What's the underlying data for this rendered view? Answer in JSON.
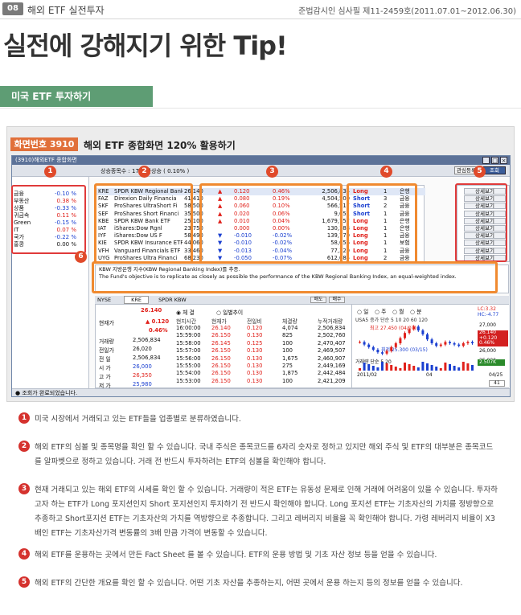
{
  "header": {
    "num": "08",
    "section": "해외 ETF 실전투자",
    "registration": "준법감시인 심사필 제11-2459호(2011.07.01~2012.06.30)"
  },
  "title": "실전에 강해지기 위한 Tip!",
  "subtitle": "미국 ETF 투자하기",
  "caption": {
    "tag": "화면번호 3910",
    "title": "해외 ETF 종합화면 120% 활용하기"
  },
  "window": {
    "title": "(3910)해외ETF 종합화면",
    "toolbar": "상승종목수 : 17   평균상승 (  0.10% )",
    "btn_consult": "관심등록",
    "btn_query": "조회",
    "status": "조회가 완료되었습니다."
  },
  "sectors": [
    {
      "name": "금융",
      "val": "-0.10 %",
      "c": "#1a3fd0"
    },
    {
      "name": "부동산",
      "val": "0.38 %",
      "c": "#e0201a"
    },
    {
      "name": "상품",
      "val": "-0.33 %",
      "c": "#1a3fd0"
    },
    {
      "name": "귀금속",
      "val": "0.11 %",
      "c": "#e0201a"
    },
    {
      "name": "Green",
      "val": "-0.15 %",
      "c": "#1a3fd0"
    },
    {
      "name": "IT",
      "val": "0.07 %",
      "c": "#e0201a"
    },
    {
      "name": "국가",
      "val": "-0.22 %",
      "c": "#1a3fd0"
    },
    {
      "name": "홍콩",
      "val": "0.00 %",
      "c": "#111"
    }
  ],
  "stocks": [
    {
      "sym": "KRE",
      "name": "SPDR KBW Regional Banki",
      "price": "26.140",
      "d": "▲",
      "chg": "0.120",
      "pct": "0.46%",
      "vol": "2,506,834",
      "type": "Long",
      "lev": "1",
      "sec": "은행",
      "up": true
    },
    {
      "sym": "FAZ",
      "name": "Direxion Daily Financia",
      "price": "41.410",
      "d": "▲",
      "chg": "0.080",
      "pct": "0.19%",
      "vol": "4,504,500",
      "type": "Short",
      "lev": "3",
      "sec": "금융",
      "up": true
    },
    {
      "sym": "SKF",
      "name": "ProShares UltraShort Fi",
      "price": "58.500",
      "d": "▲",
      "chg": "0.060",
      "pct": "0.10%",
      "vol": "566,517",
      "type": "Short",
      "lev": "2",
      "sec": "금융",
      "up": true
    },
    {
      "sym": "SEF",
      "name": "ProShares Short Financi",
      "price": "35.500",
      "d": "▲",
      "chg": "0.020",
      "pct": "0.06%",
      "vol": "9,651",
      "type": "Short",
      "lev": "1",
      "sec": "금융",
      "up": true
    },
    {
      "sym": "KBE",
      "name": "SPDR KBW Bank ETF",
      "price": "25.100",
      "d": "▲",
      "chg": "0.010",
      "pct": "0.04%",
      "vol": "1,679,757",
      "type": "Long",
      "lev": "1",
      "sec": "은행",
      "up": true
    },
    {
      "sym": "IAT",
      "name": "iShares:Dow Rgnl",
      "price": "23.750",
      "d": "",
      "chg": "0.000",
      "pct": "0.00%",
      "vol": "130,188",
      "type": "Long",
      "lev": "1",
      "sec": "은행",
      "up": true
    },
    {
      "sym": "IYF",
      "name": "iShares:Dow US F",
      "price": "58.490",
      "d": "▼",
      "chg": "-0.010",
      "pct": "-0.02%",
      "vol": "139,770",
      "type": "Long",
      "lev": "1",
      "sec": "금융",
      "up": false
    },
    {
      "sym": "KIE",
      "name": "SPDR KBW Insurance ETF",
      "price": "44.060",
      "d": "▼",
      "chg": "-0.010",
      "pct": "-0.02%",
      "vol": "58,656",
      "type": "Long",
      "lev": "1",
      "sec": "보험",
      "up": false
    },
    {
      "sym": "VFH",
      "name": "Vanguard Financials ETF",
      "price": "33.460",
      "d": "▼",
      "chg": "-0.013",
      "pct": "-0.04%",
      "vol": "77,320",
      "type": "Long",
      "lev": "1",
      "sec": "금융",
      "up": false
    },
    {
      "sym": "UYG",
      "name": "ProShares Ultra Financi",
      "price": "68.230",
      "d": "▼",
      "chg": "-0.050",
      "pct": "-0.07%",
      "vol": "612,085",
      "type": "Long",
      "lev": "2",
      "sec": "금융",
      "up": false
    }
  ],
  "detail_label": "상세보기",
  "description": {
    "line1": "KBW 지방은행 지수(KBW Regional Banking Index)를 추종.",
    "line2": "The Fund's objective is to replicate as closely as possible the performance of the KBW Regional Banking Index, an equal-weighted index."
  },
  "quote": {
    "market": "NYSE",
    "sym": "KRE",
    "name": "SPDR KBW",
    "price": "26.140",
    "chg": "0.120",
    "pct": "0.46%",
    "lbl_cur": "현재가",
    "lbl_vol": "거래량",
    "lbl_prev": "전일가",
    "lbl_p": "전 일",
    "lbl_o": "시 가",
    "lbl_h": "고 가",
    "lbl_l": "저 가",
    "vol": "2,506,834",
    "prev": "26,020",
    "p": "2,506,834",
    "o": "26,000",
    "h": "26,350",
    "l": "25,980",
    "radio1": "체 결",
    "radio2": "일별추이",
    "btn_buy": "매도",
    "btn_sell": "매수"
  },
  "ticks_head": [
    "현지시간",
    "현재가",
    "전일비",
    "체결량",
    "누적거래량"
  ],
  "ticks": [
    [
      "16:00:00",
      "26.140",
      "0.120",
      "4,074",
      "2,506,834"
    ],
    [
      "15:59:00",
      "26.150",
      "0.130",
      "825",
      "2,502,760"
    ],
    [
      "15:58:00",
      "26.145",
      "0.125",
      "100",
      "2,470,407"
    ],
    [
      "15:57:00",
      "26.150",
      "0.130",
      "100",
      "2,469,507"
    ],
    [
      "15:56:00",
      "26.150",
      "0.130",
      "1,675",
      "2,460,907"
    ],
    [
      "15:55:00",
      "26.150",
      "0.130",
      "275",
      "2,449,169"
    ],
    [
      "15:54:00",
      "26.150",
      "0.130",
      "1,875",
      "2,442,484"
    ],
    [
      "15:53:00",
      "26.150",
      "0.130",
      "100",
      "2,421,209"
    ]
  ],
  "chart": {
    "tabs": [
      "일",
      "주",
      "월",
      "분"
    ],
    "legend": "USA5 증가 단순 5 10 20 60 120",
    "high": "최고 27.450 (04/07)",
    "low": "최저 25.300 (03/15)",
    "vol_lbl": "거래량 단순 5 20",
    "date1": "2011/02",
    "date2": "04",
    "date3": "04/25",
    "lc": "LC:3.32",
    "hc": "HC:-4.77",
    "tag_price": "26.140",
    "tag_chg": "+0.120",
    "tag_pct": "0.46%",
    "tag_vol": "2.507K",
    "y1": "27,000",
    "y2": "26,000",
    "y3": "25,000",
    "zoom": "41"
  },
  "notes": [
    "미국 시장에서 거래되고 있는 ETF들을 업종별로 분류하였습니다.",
    "해외 ETF의 심볼 및 종목명을 확인 할 수 있습니다. 국내 주식은 종목코드를 6자리 숫자로 정하고 있지만 해외 주식 및 ETF의 대부분은 종목코드를 알파벳으로 정하고 있습니다. 거래 전 반드시 투자하려는 ETF의 심볼을 확인해야 합니다.",
    "현재 거래되고 있는 해외 ETF의 시세를 확인 할 수 있습니다. 거래량이 적은 ETF는 유동성 문제로 인해 거래에 어려움이 있을 수 있습니다. 투자하고자 하는 ETF가 Long 포지션인지 Short 포지션인지 투자하기 전 반드시 확인해야 합니다. Long 포지션 ETF는 기초자산의 가치를 정방향으로 추종하고 Short포지션 ETF는 기초자산의 가치를 역방향으로 추종합니다. 그리고 레버리지 비율을 꼭 확인해야 합니다. 가령 레버리지 비율이 X3 배인 ETF는 기초자산가격 변동률의 3배 만큼 가격이 변동할 수 있습니다.",
    "해외 ETF를 운용하는 곳에서 만든 Fact Sheet 를 볼 수 있습니다. ETF의 운용 방법 및 기초 자산 정보 등을 얻을 수 있습니다.",
    "해외 ETF의 간단한 개요를 확인 할 수 있습니다. 어떤 기초 자산을 추종하는지, 어떤 곳에서 운용 하는지 등의 정보를 얻을 수 있습니다."
  ],
  "note_nums": [
    "1",
    "2",
    "3",
    "4",
    "5"
  ],
  "badges": [
    "1",
    "2",
    "3",
    "4",
    "5",
    "6"
  ]
}
